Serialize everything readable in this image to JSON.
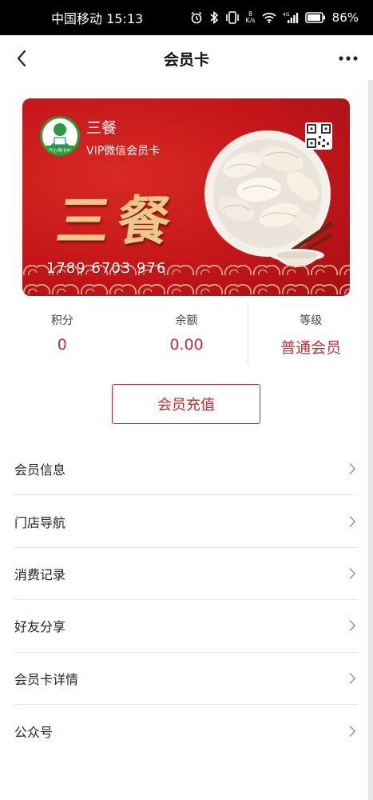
{
  "status_bar": {
    "carrier_time": "中国移动 15:13",
    "net_speed_value": "8",
    "net_speed_unit": "K/s",
    "network": "4G",
    "battery": "86%"
  },
  "nav": {
    "title": "会员卡"
  },
  "card": {
    "brand_name": "三餐",
    "card_type": "VIP微信会员卡",
    "calligraphy": "三餐",
    "card_number": "1789 6703 976",
    "logo_text": "开心喝卡包",
    "colors": {
      "background": "#c4161a",
      "gold": "#e9c98a"
    }
  },
  "stats": [
    {
      "label": "积分",
      "value": "0"
    },
    {
      "label": "余额",
      "value": "0.00"
    },
    {
      "label": "等级",
      "value": "普通会员"
    }
  ],
  "recharge_button": "会员充值",
  "menu": [
    {
      "label": "会员信息"
    },
    {
      "label": "门店导航"
    },
    {
      "label": "消费记录"
    },
    {
      "label": "好友分享"
    },
    {
      "label": "会员卡详情"
    },
    {
      "label": "公众号"
    }
  ],
  "theme": {
    "accent": "#c2303a"
  }
}
